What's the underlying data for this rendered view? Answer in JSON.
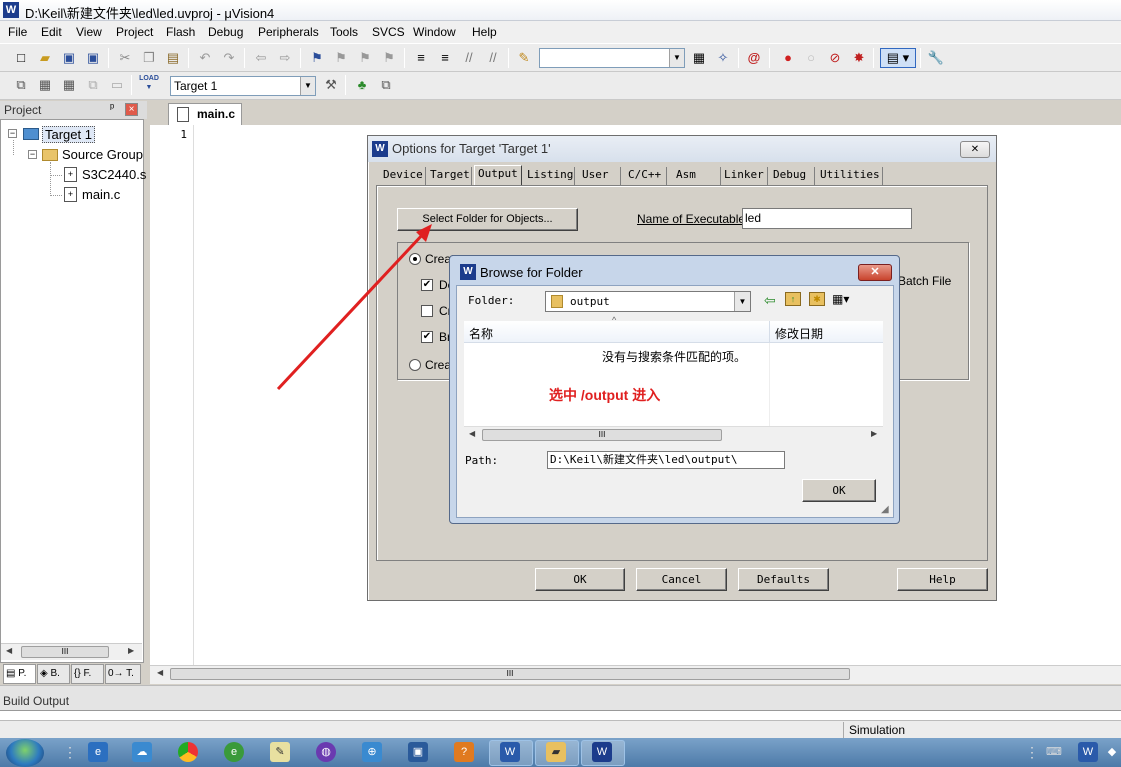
{
  "window": {
    "title": "D:\\Keil\\新建文件夹\\led\\led.uvproj - μVision4",
    "app_icon": "W"
  },
  "menu": [
    "File",
    "Edit",
    "View",
    "Project",
    "Flash",
    "Debug",
    "Peripherals",
    "Tools",
    "SVCS",
    "Window",
    "Help"
  ],
  "toolbar": {
    "find_combo_value": "",
    "target_combo_value": "Target 1",
    "load_label": "LOAD"
  },
  "project": {
    "header": "Project",
    "pin_glyph": "ᵖ",
    "close_glyph": "×",
    "tree": {
      "root": "Target 1",
      "group": "Source Group",
      "files": [
        "S3C2440.s",
        "main.c"
      ]
    },
    "tabs": [
      "P.",
      "B.",
      "F.",
      "T."
    ]
  },
  "editor": {
    "tab": "main.c",
    "line_numbers": [
      "1"
    ]
  },
  "build_output": {
    "header": "Build Output"
  },
  "statusbar": {
    "mode": "Simulation"
  },
  "options_dialog": {
    "title": "Options for Target 'Target 1'",
    "close_glyph": "✕",
    "tabs": [
      "Device",
      "Target",
      "Output",
      "Listing",
      "User",
      "C/C++",
      "Asm",
      "Linker",
      "Debug",
      "Utilities"
    ],
    "active_tab": "Output",
    "select_folder_button": "Select Folder for Objects...",
    "name_exec_label": "Name of Executable:",
    "name_exec_value": "led",
    "radio_create_exec": "Creat",
    "check_debug": "De",
    "check_cr": "Cr",
    "check_br": "Br",
    "radio_create_lib": "Creat",
    "batch_file_label": "Batch File",
    "buttons": {
      "ok": "OK",
      "cancel": "Cancel",
      "defaults": "Defaults",
      "help": "Help"
    }
  },
  "browse_dialog": {
    "title": "Browse for Folder",
    "close_glyph": "✕",
    "folder_label": "Folder:",
    "folder_value": "output",
    "col_name": "名称",
    "col_modified": "修改日期",
    "empty_message": "没有与搜索条件匹配的项。",
    "annotation": "选中 /output 进入",
    "path_label": "Path:",
    "path_value": "D:\\Keil\\新建文件夹\\led\\output\\",
    "ok_button": "OK",
    "scroll_grip": "III",
    "sort_glyph": "^"
  },
  "scroll_grip": "III",
  "colors": {
    "annotation_red": "#e02020",
    "title_blue": "#1c3c8c"
  }
}
